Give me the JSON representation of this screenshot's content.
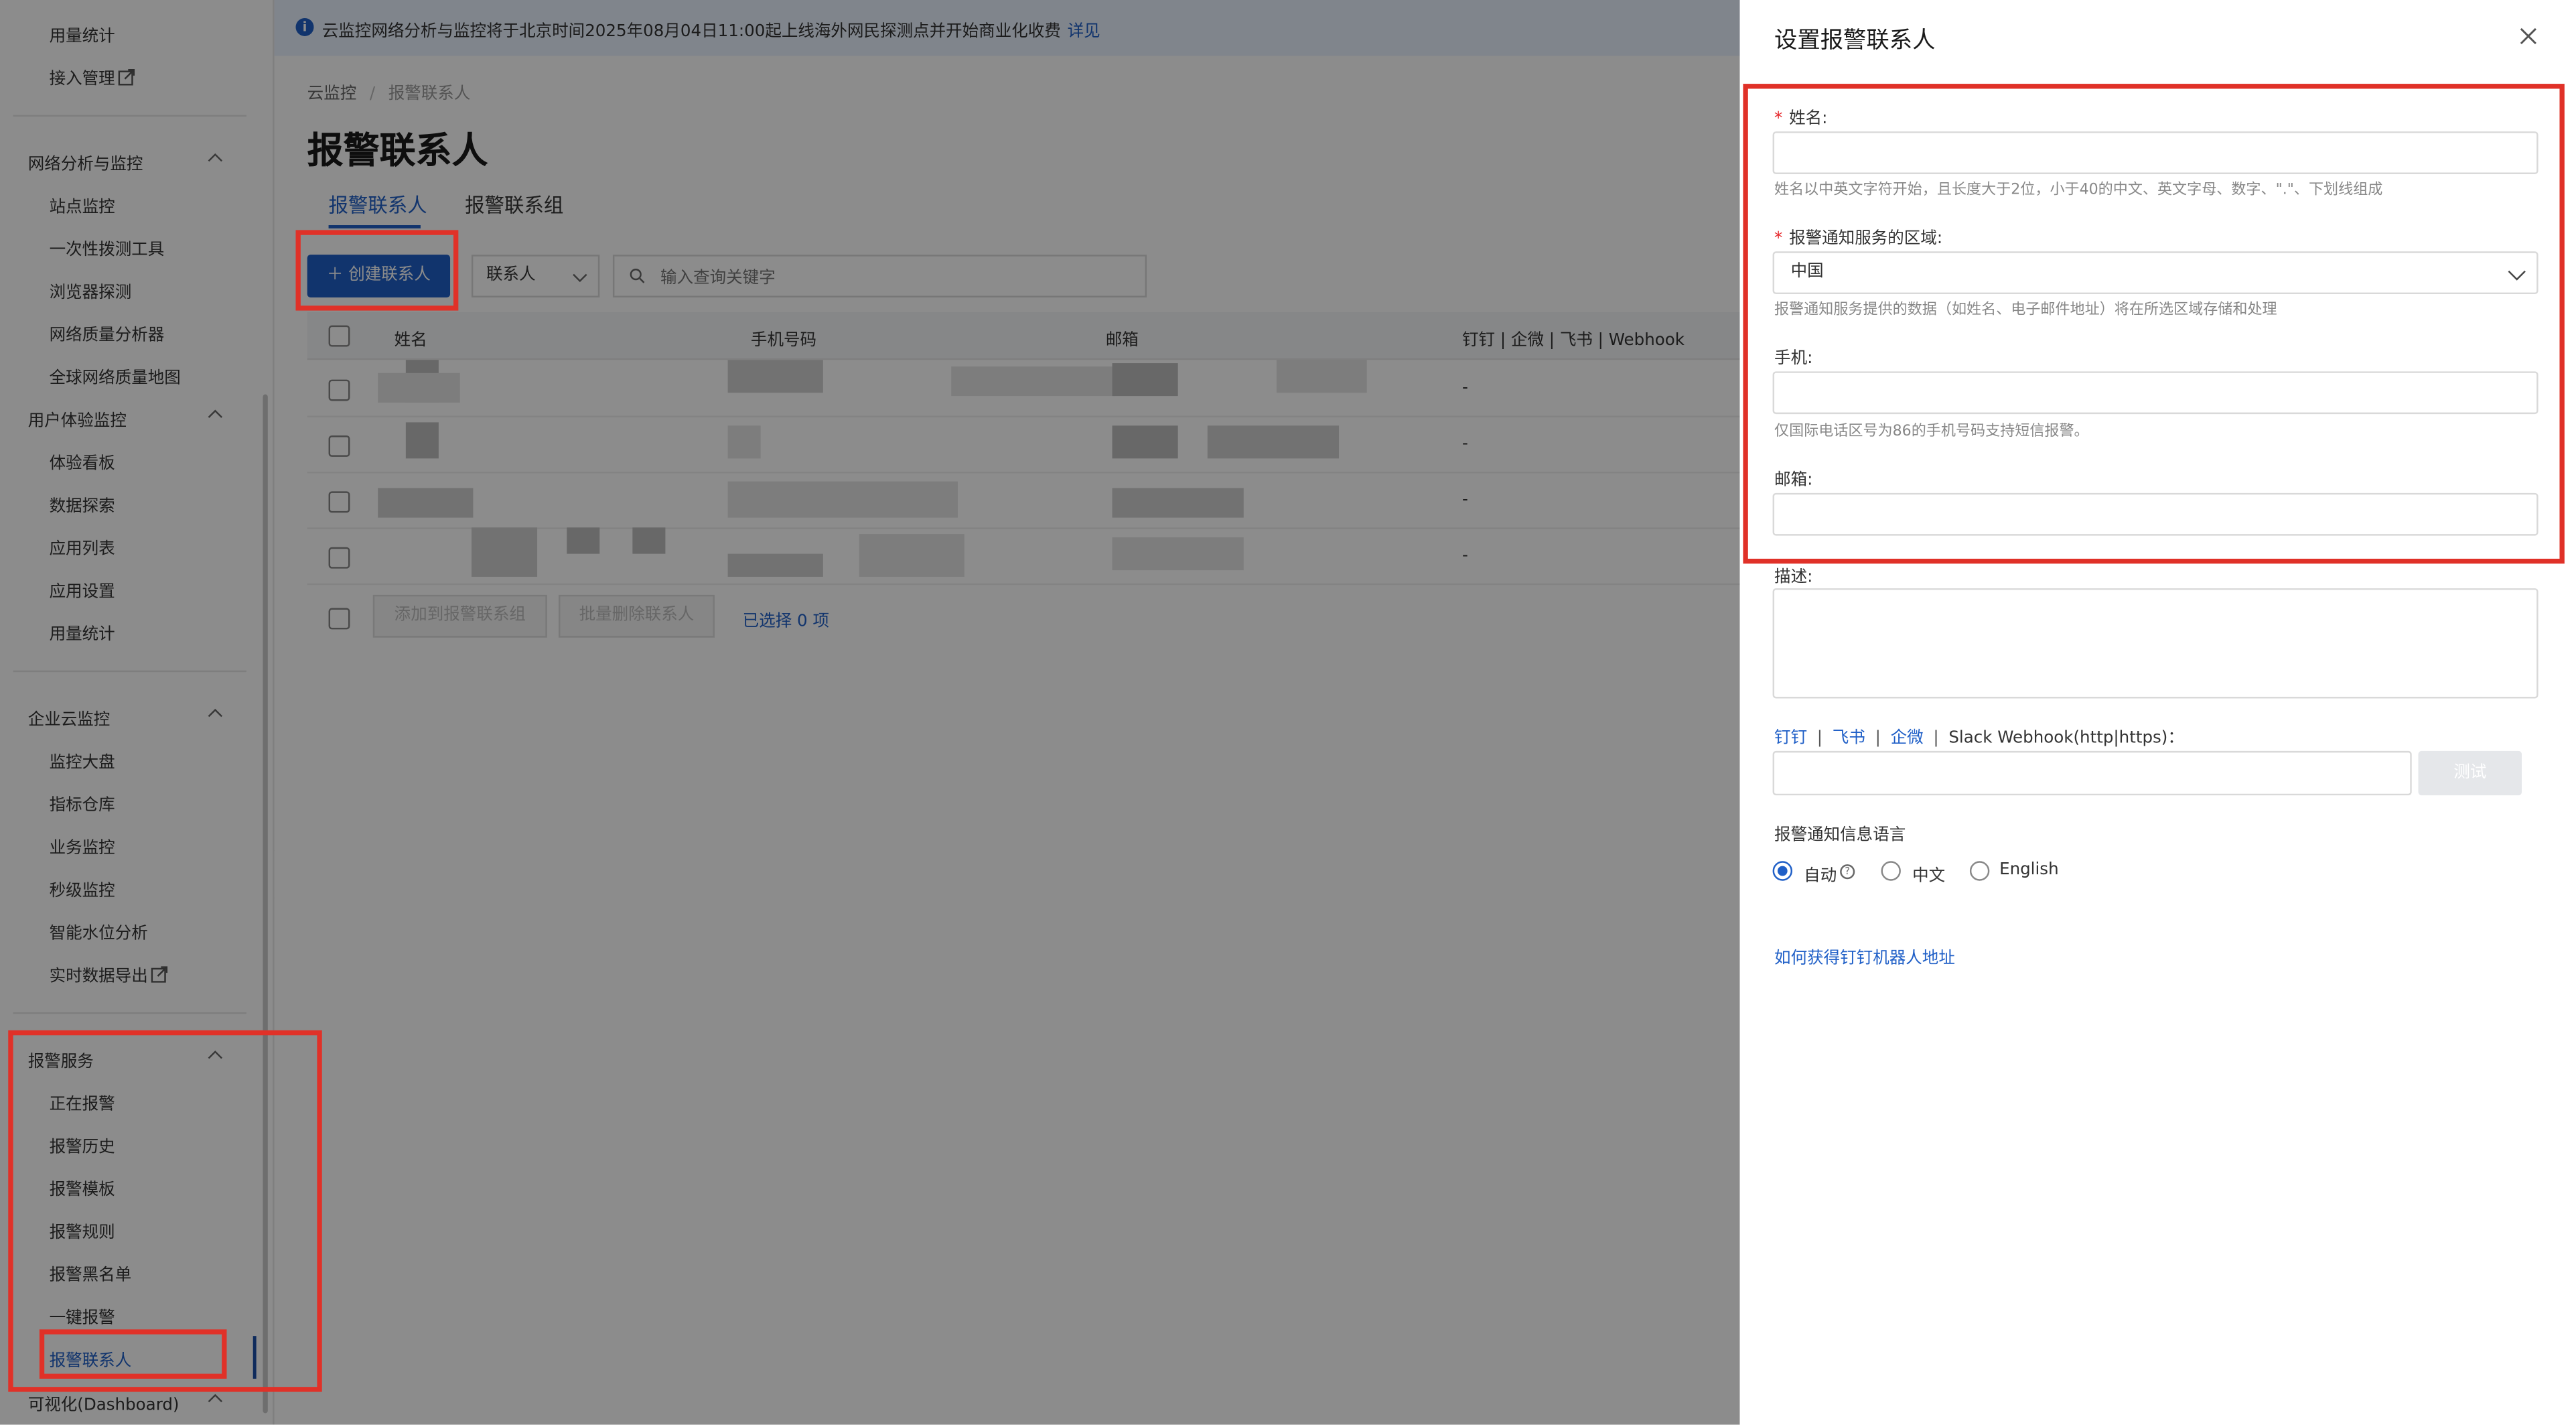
{
  "sidebar": {
    "top_items": [
      "用量统计",
      "接入管理"
    ],
    "groups": [
      {
        "title": "网络分析与监控",
        "items": [
          "站点监控",
          "一次性拨测工具",
          "浏览器探测",
          "网络质量分析器",
          "全球网络质量地图"
        ]
      },
      {
        "title": "用户体验监控",
        "items": [
          "体验看板",
          "数据探索",
          "应用列表",
          "应用设置",
          "用量统计"
        ]
      },
      {
        "title": "企业云监控",
        "items": [
          "监控大盘",
          "指标仓库",
          "业务监控",
          "秒级监控",
          "智能水位分析",
          "实时数据导出"
        ]
      },
      {
        "title": "报警服务",
        "items": [
          "正在报警",
          "报警历史",
          "报警模板",
          "报警规则",
          "报警黑名单",
          "一键报警",
          "报警联系人"
        ]
      },
      {
        "title": "可视化(Dashboard)",
        "items": []
      }
    ]
  },
  "notice": {
    "text": "云监控网络分析与监控将于北京时间2025年08月04日11:00起上线海外网民探测点并开始商业化收费",
    "link": "详见"
  },
  "breadcrumb": {
    "root": "云监控",
    "current": "报警联系人"
  },
  "main": {
    "title": "报警联系人",
    "tabs": [
      "报警联系人",
      "报警联系组"
    ],
    "create_button": "创建联系人",
    "filter_select": "联系人",
    "search_placeholder": "输入查询关键字",
    "columns": [
      "姓名",
      "手机号码",
      "邮箱",
      "钉钉 | 企微 | 飞书 | Webhook"
    ],
    "rows": [
      {
        "webhook": "-"
      },
      {
        "webhook": "-"
      },
      {
        "webhook": "-"
      },
      {
        "webhook": "-"
      }
    ],
    "batch_add_button": "添加到报警联系组",
    "batch_delete_button": "批量删除联系人",
    "selected_text": "已选择 0 项"
  },
  "drawer": {
    "title": "设置报警联系人",
    "name": {
      "label": "姓名:",
      "help": "姓名以中英文字符开始，且长度大于2位，小于40的中文、英文字母、数字、\".\"、下划线组成",
      "value": ""
    },
    "region": {
      "label": "报警通知服务的区域:",
      "value": "中国",
      "help": "报警通知服务提供的数据（如姓名、电子邮件地址）将在所选区域存储和处理"
    },
    "phone": {
      "label": "手机:",
      "help": "仅国际电话区号为86的手机号码支持短信报警。",
      "value": ""
    },
    "email": {
      "label": "邮箱:",
      "value": ""
    },
    "description": {
      "label": "描述:",
      "value": ""
    },
    "webhook": {
      "links": [
        "钉钉",
        "飞书",
        "企微"
      ],
      "suffix": "Slack Webhook(http|https)：",
      "test_button": "测试",
      "value": ""
    },
    "language": {
      "label": "报警通知信息语言",
      "options": [
        "自动",
        "中文",
        "English"
      ],
      "selected": "自动"
    },
    "howto_link": "如何获得钉钉机器人地址"
  },
  "colors": {
    "accent": "#1f5fc7",
    "highlight": "#e03128",
    "required": "#e5252a"
  }
}
